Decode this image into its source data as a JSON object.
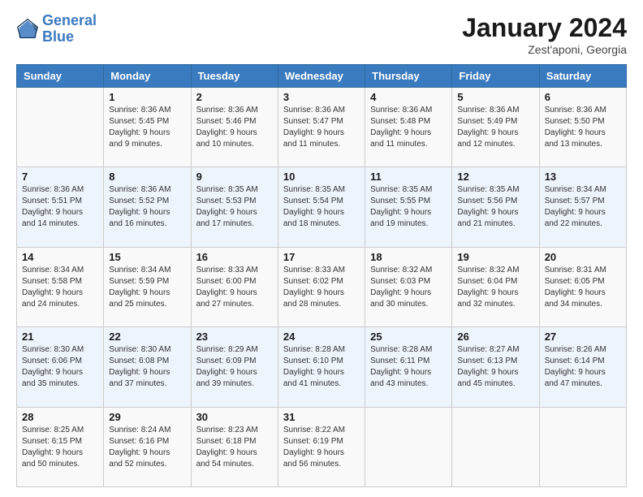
{
  "logo": {
    "line1": "General",
    "line2": "Blue"
  },
  "title": "January 2024",
  "subtitle": "Zest'aponi, Georgia",
  "days_header": [
    "Sunday",
    "Monday",
    "Tuesday",
    "Wednesday",
    "Thursday",
    "Friday",
    "Saturday"
  ],
  "weeks": [
    [
      {
        "num": "",
        "sunrise": "",
        "sunset": "",
        "daylight": ""
      },
      {
        "num": "1",
        "sunrise": "Sunrise: 8:36 AM",
        "sunset": "Sunset: 5:45 PM",
        "daylight": "Daylight: 9 hours and 9 minutes."
      },
      {
        "num": "2",
        "sunrise": "Sunrise: 8:36 AM",
        "sunset": "Sunset: 5:46 PM",
        "daylight": "Daylight: 9 hours and 10 minutes."
      },
      {
        "num": "3",
        "sunrise": "Sunrise: 8:36 AM",
        "sunset": "Sunset: 5:47 PM",
        "daylight": "Daylight: 9 hours and 11 minutes."
      },
      {
        "num": "4",
        "sunrise": "Sunrise: 8:36 AM",
        "sunset": "Sunset: 5:48 PM",
        "daylight": "Daylight: 9 hours and 11 minutes."
      },
      {
        "num": "5",
        "sunrise": "Sunrise: 8:36 AM",
        "sunset": "Sunset: 5:49 PM",
        "daylight": "Daylight: 9 hours and 12 minutes."
      },
      {
        "num": "6",
        "sunrise": "Sunrise: 8:36 AM",
        "sunset": "Sunset: 5:50 PM",
        "daylight": "Daylight: 9 hours and 13 minutes."
      }
    ],
    [
      {
        "num": "7",
        "sunrise": "Sunrise: 8:36 AM",
        "sunset": "Sunset: 5:51 PM",
        "daylight": "Daylight: 9 hours and 14 minutes."
      },
      {
        "num": "8",
        "sunrise": "Sunrise: 8:36 AM",
        "sunset": "Sunset: 5:52 PM",
        "daylight": "Daylight: 9 hours and 16 minutes."
      },
      {
        "num": "9",
        "sunrise": "Sunrise: 8:35 AM",
        "sunset": "Sunset: 5:53 PM",
        "daylight": "Daylight: 9 hours and 17 minutes."
      },
      {
        "num": "10",
        "sunrise": "Sunrise: 8:35 AM",
        "sunset": "Sunset: 5:54 PM",
        "daylight": "Daylight: 9 hours and 18 minutes."
      },
      {
        "num": "11",
        "sunrise": "Sunrise: 8:35 AM",
        "sunset": "Sunset: 5:55 PM",
        "daylight": "Daylight: 9 hours and 19 minutes."
      },
      {
        "num": "12",
        "sunrise": "Sunrise: 8:35 AM",
        "sunset": "Sunset: 5:56 PM",
        "daylight": "Daylight: 9 hours and 21 minutes."
      },
      {
        "num": "13",
        "sunrise": "Sunrise: 8:34 AM",
        "sunset": "Sunset: 5:57 PM",
        "daylight": "Daylight: 9 hours and 22 minutes."
      }
    ],
    [
      {
        "num": "14",
        "sunrise": "Sunrise: 8:34 AM",
        "sunset": "Sunset: 5:58 PM",
        "daylight": "Daylight: 9 hours and 24 minutes."
      },
      {
        "num": "15",
        "sunrise": "Sunrise: 8:34 AM",
        "sunset": "Sunset: 5:59 PM",
        "daylight": "Daylight: 9 hours and 25 minutes."
      },
      {
        "num": "16",
        "sunrise": "Sunrise: 8:33 AM",
        "sunset": "Sunset: 6:00 PM",
        "daylight": "Daylight: 9 hours and 27 minutes."
      },
      {
        "num": "17",
        "sunrise": "Sunrise: 8:33 AM",
        "sunset": "Sunset: 6:02 PM",
        "daylight": "Daylight: 9 hours and 28 minutes."
      },
      {
        "num": "18",
        "sunrise": "Sunrise: 8:32 AM",
        "sunset": "Sunset: 6:03 PM",
        "daylight": "Daylight: 9 hours and 30 minutes."
      },
      {
        "num": "19",
        "sunrise": "Sunrise: 8:32 AM",
        "sunset": "Sunset: 6:04 PM",
        "daylight": "Daylight: 9 hours and 32 minutes."
      },
      {
        "num": "20",
        "sunrise": "Sunrise: 8:31 AM",
        "sunset": "Sunset: 6:05 PM",
        "daylight": "Daylight: 9 hours and 34 minutes."
      }
    ],
    [
      {
        "num": "21",
        "sunrise": "Sunrise: 8:30 AM",
        "sunset": "Sunset: 6:06 PM",
        "daylight": "Daylight: 9 hours and 35 minutes."
      },
      {
        "num": "22",
        "sunrise": "Sunrise: 8:30 AM",
        "sunset": "Sunset: 6:08 PM",
        "daylight": "Daylight: 9 hours and 37 minutes."
      },
      {
        "num": "23",
        "sunrise": "Sunrise: 8:29 AM",
        "sunset": "Sunset: 6:09 PM",
        "daylight": "Daylight: 9 hours and 39 minutes."
      },
      {
        "num": "24",
        "sunrise": "Sunrise: 8:28 AM",
        "sunset": "Sunset: 6:10 PM",
        "daylight": "Daylight: 9 hours and 41 minutes."
      },
      {
        "num": "25",
        "sunrise": "Sunrise: 8:28 AM",
        "sunset": "Sunset: 6:11 PM",
        "daylight": "Daylight: 9 hours and 43 minutes."
      },
      {
        "num": "26",
        "sunrise": "Sunrise: 8:27 AM",
        "sunset": "Sunset: 6:13 PM",
        "daylight": "Daylight: 9 hours and 45 minutes."
      },
      {
        "num": "27",
        "sunrise": "Sunrise: 8:26 AM",
        "sunset": "Sunset: 6:14 PM",
        "daylight": "Daylight: 9 hours and 47 minutes."
      }
    ],
    [
      {
        "num": "28",
        "sunrise": "Sunrise: 8:25 AM",
        "sunset": "Sunset: 6:15 PM",
        "daylight": "Daylight: 9 hours and 50 minutes."
      },
      {
        "num": "29",
        "sunrise": "Sunrise: 8:24 AM",
        "sunset": "Sunset: 6:16 PM",
        "daylight": "Daylight: 9 hours and 52 minutes."
      },
      {
        "num": "30",
        "sunrise": "Sunrise: 8:23 AM",
        "sunset": "Sunset: 6:18 PM",
        "daylight": "Daylight: 9 hours and 54 minutes."
      },
      {
        "num": "31",
        "sunrise": "Sunrise: 8:22 AM",
        "sunset": "Sunset: 6:19 PM",
        "daylight": "Daylight: 9 hours and 56 minutes."
      },
      {
        "num": "",
        "sunrise": "",
        "sunset": "",
        "daylight": ""
      },
      {
        "num": "",
        "sunrise": "",
        "sunset": "",
        "daylight": ""
      },
      {
        "num": "",
        "sunrise": "",
        "sunset": "",
        "daylight": ""
      }
    ]
  ]
}
